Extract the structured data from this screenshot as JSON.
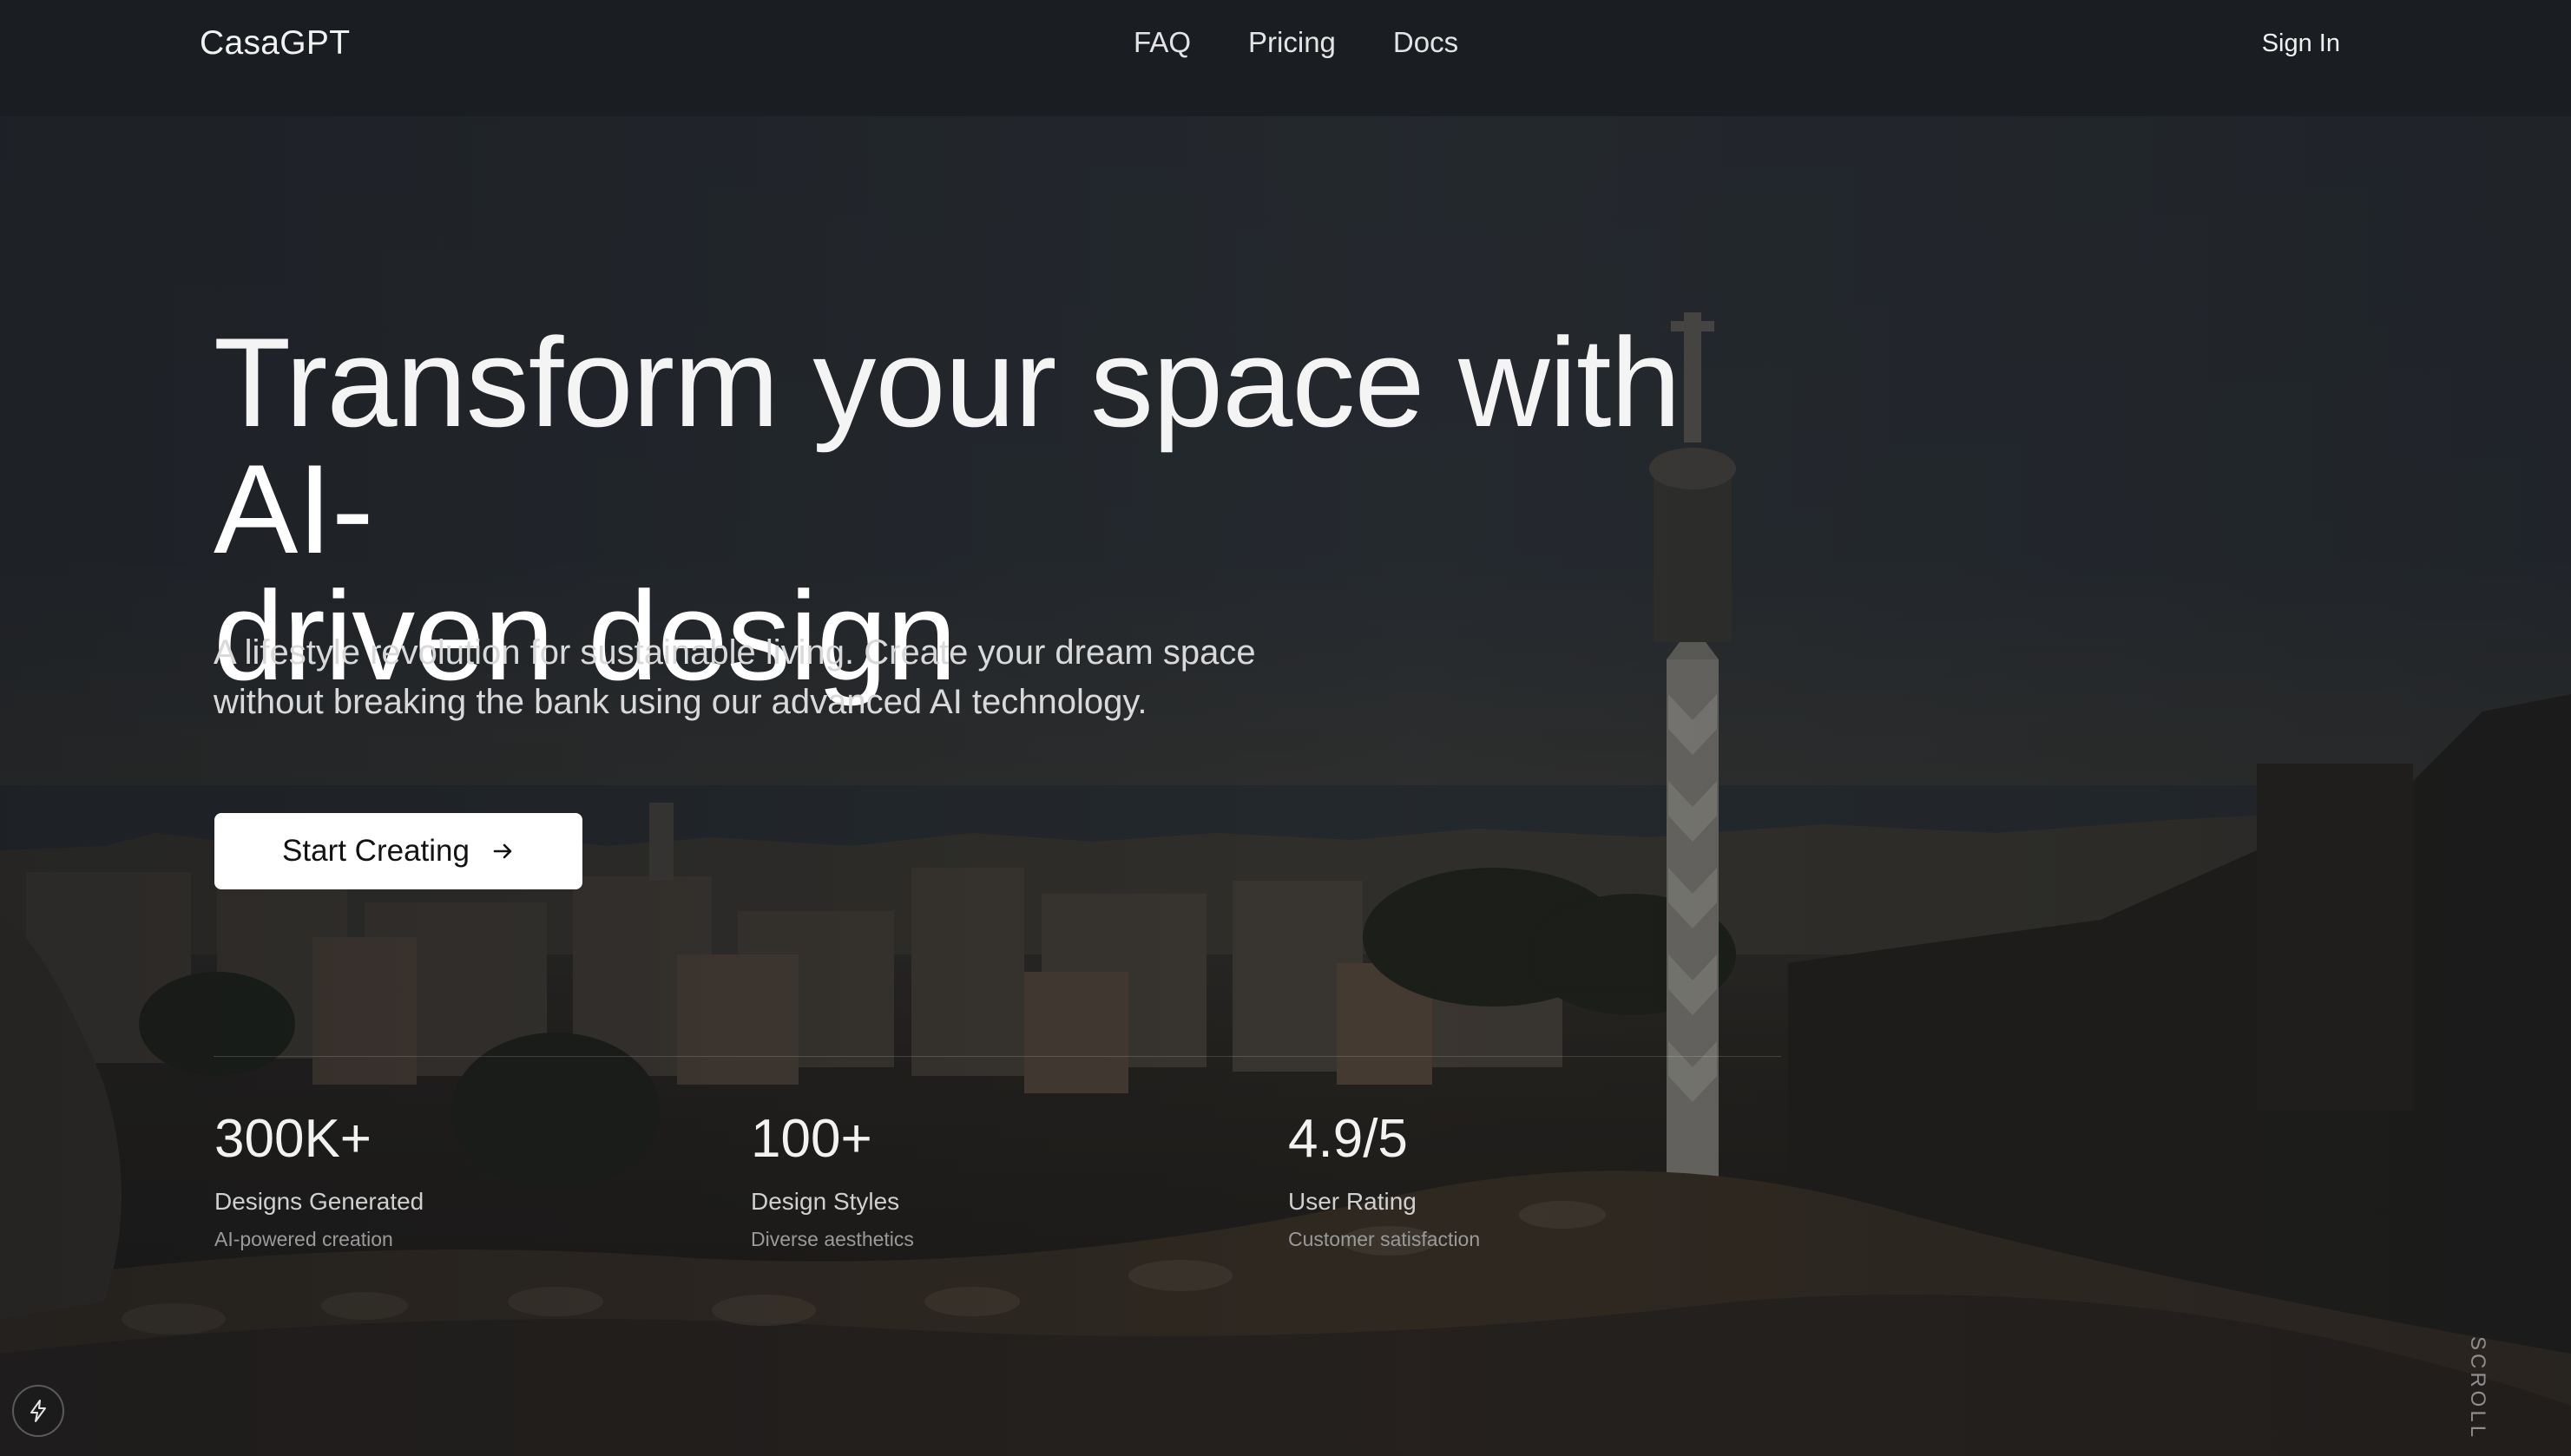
{
  "colors": {
    "nav_background": "#1a1d22",
    "cta_background": "#ffffff",
    "cta_text": "#121212",
    "text_primary": "#f4f4f4",
    "text_muted": "#9a9a9a"
  },
  "nav": {
    "brand": "CasaGPT",
    "links": [
      {
        "label": "FAQ"
      },
      {
        "label": "Pricing"
      },
      {
        "label": "Docs"
      }
    ],
    "sign_in": "Sign In"
  },
  "hero": {
    "title_light": "Transform your space with",
    "title_strong_1": "AI-",
    "title_strong_2": "driven design",
    "subtitle": "A lifestyle revolution for sustainable living. Create your dream space without breaking the bank using our advanced AI technology.",
    "cta_label": "Start Creating",
    "cta_icon": "arrow-right-icon"
  },
  "stats": [
    {
      "value": "300K+",
      "label": "Designs Generated",
      "sub": "AI-powered creation"
    },
    {
      "value": "100+",
      "label": "Design Styles",
      "sub": "Diverse aesthetics"
    },
    {
      "value": "4.9/5",
      "label": "User Rating",
      "sub": "Customer satisfaction"
    }
  ],
  "scroll_label": "SCROLL",
  "badge_icon": "lightning-icon"
}
